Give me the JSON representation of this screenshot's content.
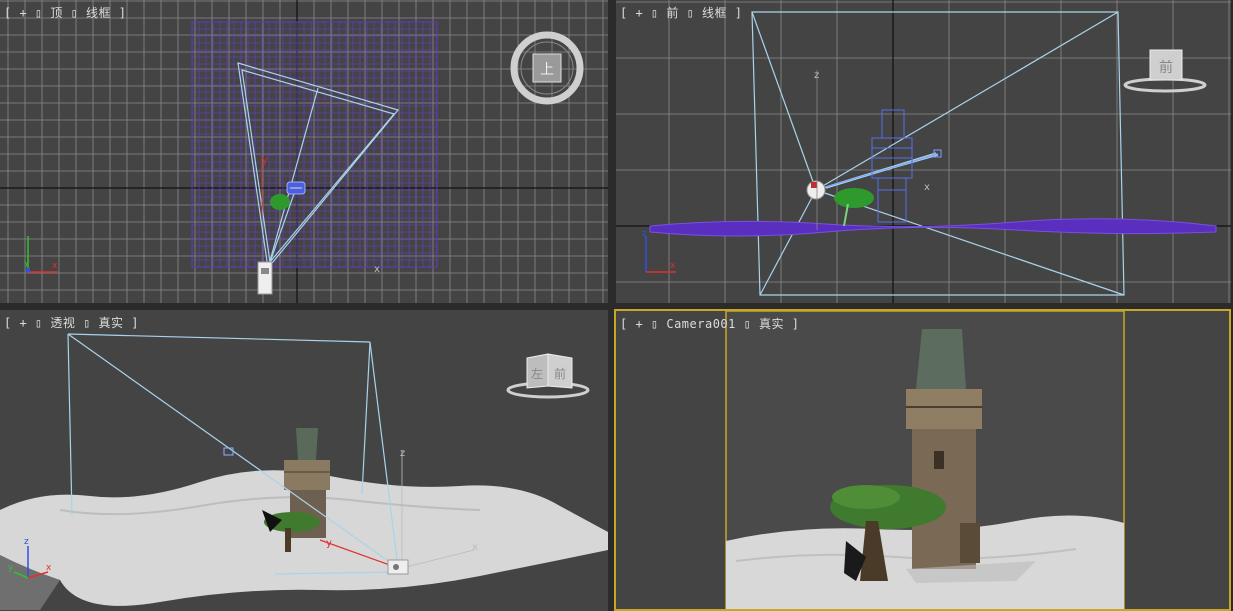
{
  "viewports": {
    "top": {
      "label": "[ + ▯ 顶 ▯ 线框 ]",
      "viewcube_face": "上",
      "shading": "wireframe"
    },
    "front": {
      "label": "[ + ▯ 前 ▯ 线框 ]",
      "viewcube_face": "前",
      "shading": "wireframe"
    },
    "perspective": {
      "label": "[ + ▯ 透视 ▯ 真实 ]",
      "viewcube_face_left": "左",
      "viewcube_face_front": "前",
      "shading": "realistic"
    },
    "camera": {
      "label": "[ + ▯ Camera001 ▯ 真实 ]",
      "shading": "realistic",
      "active": true
    }
  },
  "axes": {
    "x": "x",
    "y": "y",
    "z": "z"
  },
  "colors": {
    "viewport_bg": "#444444",
    "grid": "#8a8a8a",
    "grid_axis": "#101010",
    "camera_frustum": "#a9d3ea",
    "terrain_wire": "#5a2fbf",
    "active_border": "#c8a628",
    "axis_x": "#e03030",
    "axis_y": "#30c030",
    "axis_z": "#3050e0"
  },
  "icons": {
    "viewcube": "viewcube-icon",
    "camera": "camera-icon",
    "tree": "tree-icon",
    "tower": "tower-icon"
  }
}
